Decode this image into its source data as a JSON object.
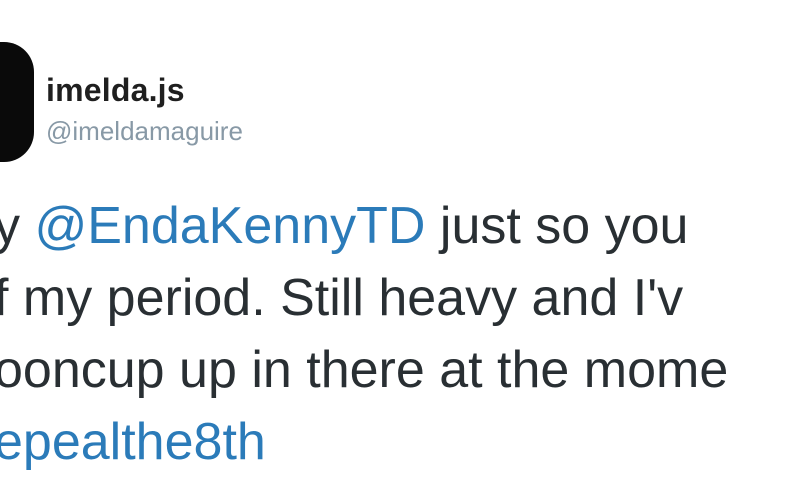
{
  "user": {
    "display_name": "imelda.js",
    "handle": "@imeldamaguire"
  },
  "tweet": {
    "line1_prefix": "y ",
    "mention": "@EndaKennyTD",
    "line1_suffix": " just so you",
    "line2": "f my period. Still heavy and I'v",
    "line3": "ooncup up in there at the mome",
    "hashtag": "epealthe8th"
  },
  "colors": {
    "link": "#2b7bb9",
    "text": "#292f33",
    "handle": "#8899a6"
  }
}
